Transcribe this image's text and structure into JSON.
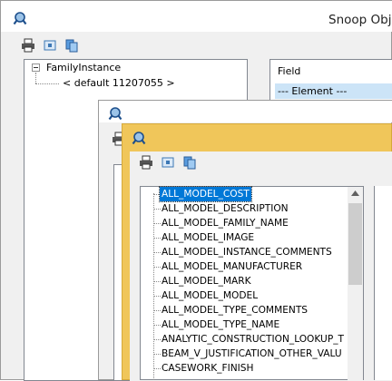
{
  "windows": {
    "back": {
      "title": "Snoop Obj",
      "tree_root": "FamilyInstance",
      "tree_child": "< default  11207055 >",
      "field_header": "Field",
      "field_row": "--- Element ---"
    },
    "front": {
      "properties": [
        "ALL_MODEL_COST",
        "ALL_MODEL_DESCRIPTION",
        "ALL_MODEL_FAMILY_NAME",
        "ALL_MODEL_IMAGE",
        "ALL_MODEL_INSTANCE_COMMENTS",
        "ALL_MODEL_MANUFACTURER",
        "ALL_MODEL_MARK",
        "ALL_MODEL_MODEL",
        "ALL_MODEL_TYPE_COMMENTS",
        "ALL_MODEL_TYPE_NAME",
        "ANALYTIC_CONSTRUCTION_LOOKUP_T",
        "BEAM_V_JUSTIFICATION_OTHER_VALU",
        "CASEWORK_FINISH"
      ],
      "selected_index": 0
    }
  },
  "icons": [
    "snoop-icon",
    "print-icon",
    "snapshot-icon",
    "copy-icon",
    "tree-collapse-icon"
  ],
  "colors": {
    "back_frame": "#f0f0f0",
    "front_frame": "#f0c65a",
    "selection": "#0078d7",
    "field_row_bg": "#cce4f7"
  }
}
